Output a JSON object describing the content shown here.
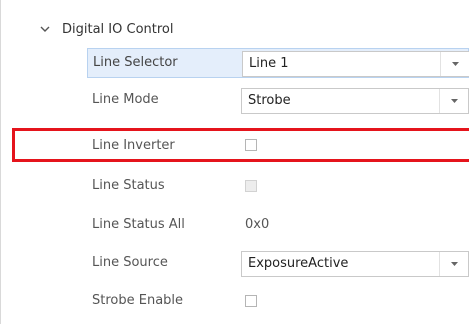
{
  "group": {
    "title": "Digital IO Control",
    "icon": "chevron-down-icon",
    "expanded": true
  },
  "properties": {
    "line_selector": {
      "label": "Line Selector",
      "value": "Line 1"
    },
    "line_mode": {
      "label": "Line Mode",
      "value": "Strobe"
    },
    "line_inverter": {
      "label": "Line Inverter",
      "checked": false
    },
    "line_status": {
      "label": "Line Status",
      "checked": false,
      "disabled": true
    },
    "line_status_all": {
      "label": "Line Status All",
      "value": "0x0"
    },
    "line_source": {
      "label": "Line Source",
      "value": "ExposureActive"
    },
    "strobe_enable": {
      "label": "Strobe Enable",
      "checked": false
    }
  },
  "colors": {
    "selected_row_bg": "#e4eefb",
    "selected_row_border": "#b8d2f0",
    "annotation_red": "#e5141c"
  }
}
